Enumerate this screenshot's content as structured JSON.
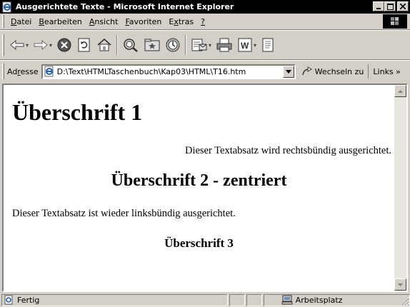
{
  "window": {
    "title": "Ausgerichtete Texte - Microsoft Internet Explorer"
  },
  "menu": {
    "items": [
      {
        "accel": "D",
        "rest": "atei"
      },
      {
        "accel": "B",
        "rest": "earbeiten"
      },
      {
        "accel": "A",
        "rest": "nsicht"
      },
      {
        "accel": "F",
        "rest": "avoriten"
      },
      {
        "pre": "E",
        "accel": "x",
        "rest": "tras"
      },
      {
        "accel": "?",
        "rest": ""
      }
    ]
  },
  "toolbar": {
    "icons": [
      "back-icon",
      "forward-icon",
      "stop-icon",
      "refresh-icon",
      "home-icon",
      "search-icon",
      "favorites-icon",
      "history-icon",
      "mail-icon",
      "print-icon",
      "edit-icon",
      "discuss-icon"
    ]
  },
  "address": {
    "label_pre": "Ad",
    "label_accel": "r",
    "label_rest": "esse",
    "value": "D:\\Text\\HTMLTaschenbuch\\Kap03\\HTML\\T16.htm",
    "go_label": "Wechseln zu",
    "links_label": "Links »"
  },
  "page": {
    "h1": "Überschrift 1",
    "p_right": "Dieser Textabsatz wird rechtsbündig ausgerichtet.",
    "h2": "Überschrift 2 - zentriert",
    "p_left": "Dieser Textabsatz ist wieder linksbündig ausgerichtet.",
    "h3": "Überschrift 3"
  },
  "status": {
    "text": "Fertig",
    "zone": "Arbeitsplatz"
  },
  "colors": {
    "titlebar": "#000000",
    "chrome": "#d4d0c8",
    "content_bg": "#ffffff"
  }
}
